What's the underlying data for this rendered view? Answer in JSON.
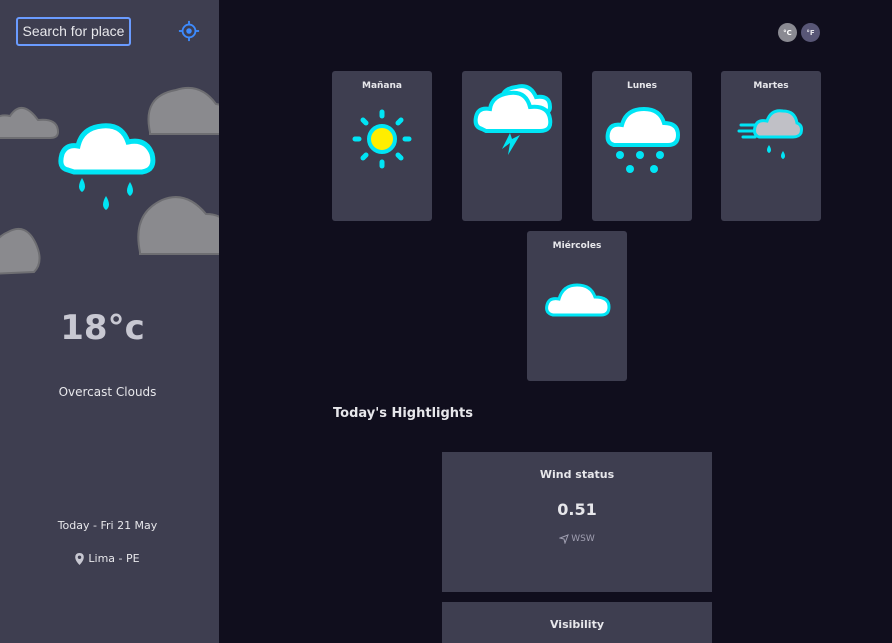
{
  "sidebar": {
    "search_label": "Search for place",
    "temperature": "18°c",
    "description": "Overcast Clouds",
    "date": "Today - Fri 21 May",
    "location": "Lima - PE"
  },
  "units": {
    "celsius": "°C",
    "fahrenheit": "°F"
  },
  "forecast": [
    {
      "day": "Mañana",
      "icon": "clear-sun-icon"
    },
    {
      "day": "",
      "icon": "thunderstorm-icon"
    },
    {
      "day": "Lunes",
      "icon": "snow-icon"
    },
    {
      "day": "Martes",
      "icon": "windy-rain-icon"
    },
    {
      "day": "Miércoles",
      "icon": "cloud-icon"
    }
  ],
  "highlights": {
    "title": "Today's Hightlights",
    "wind": {
      "title": "Wind status",
      "value": "0.51",
      "direction": "WSW"
    },
    "visibility": {
      "title": "Visibility"
    }
  },
  "colors": {
    "sidebar_bg": "#3e3e50",
    "main_bg": "#100e1d",
    "accent_cyan": "#00e5f5",
    "search_border": "#6a9bff"
  }
}
